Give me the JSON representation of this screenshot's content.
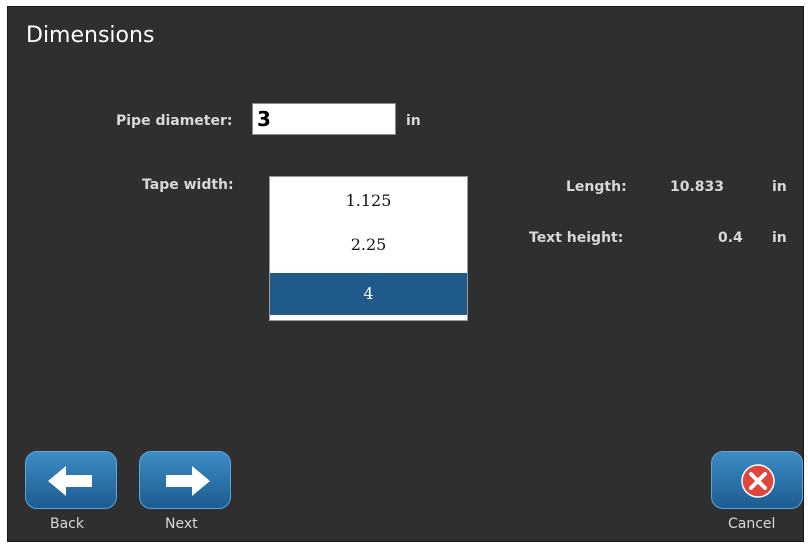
{
  "header": {
    "title": "Dimensions"
  },
  "pipe": {
    "label": "Pipe diameter:",
    "value": "3",
    "unit": "in"
  },
  "tape": {
    "label": "Tape width:",
    "options": [
      "1.125",
      "2.25",
      "4"
    ],
    "selected": "4"
  },
  "length": {
    "label": "Length:",
    "value": "10.833",
    "unit": "in"
  },
  "text_height": {
    "label": "Text height:",
    "value": "0.4",
    "unit": "in"
  },
  "footer": {
    "back_label": "Back",
    "next_label": "Next",
    "cancel_label": "Cancel"
  },
  "colors": {
    "background": "#2f2f2f",
    "selection": "#1f5a8a",
    "button": "#2a73aa",
    "cancel_icon": "#e0443c"
  },
  "icons": {
    "back": "arrow-left-icon",
    "next": "arrow-right-icon",
    "cancel": "close-circle-icon"
  }
}
